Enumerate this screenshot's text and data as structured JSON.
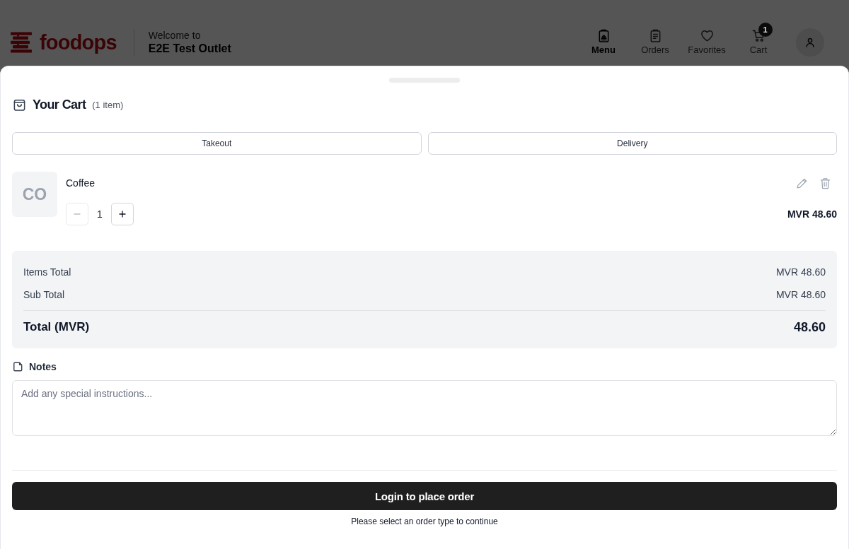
{
  "header": {
    "logo": "foodops",
    "welcome": "Welcome to",
    "outlet": "E2E Test Outlet",
    "nav": [
      {
        "kind": "menu",
        "label": "Menu",
        "selected": true
      },
      {
        "kind": "orders",
        "label": "Orders",
        "selected": false
      },
      {
        "kind": "favorites",
        "label": "Favorites",
        "selected": false
      },
      {
        "kind": "cart",
        "label": "Cart",
        "selected": false,
        "badge": "1"
      }
    ]
  },
  "cart": {
    "title": "Your Cart",
    "count": "(1 item)",
    "order_types": [
      {
        "label": "Takeout",
        "selected": false
      },
      {
        "label": "Delivery",
        "selected": false
      }
    ],
    "items": [
      {
        "thumb": "CO",
        "name": "Coffee",
        "quantity": "1",
        "decrease_disabled": true,
        "price": "MVR 48.60"
      }
    ],
    "summary": [
      {
        "label": "Items Total",
        "value": "MVR 48.60"
      },
      {
        "label": "Sub Total",
        "value": "MVR 48.60"
      }
    ],
    "total": {
      "label": "Total (MVR)",
      "value": "48.60"
    },
    "notes": {
      "label": "Notes",
      "placeholder": "Add any special instructions..."
    },
    "submit": "Login to place order",
    "hint": "Please select an order type to continue"
  }
}
